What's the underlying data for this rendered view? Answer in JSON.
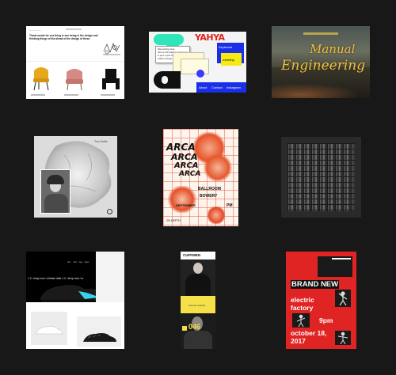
{
  "gallery": {
    "tiles": [
      {
        "id": "furniture",
        "nav": "— — — —",
        "tagline": "Thank words for one thing is one being in the design and thinking things of the ahead of the design of these."
      },
      {
        "id": "collage",
        "dialog_lines": [
          "Was working since",
          "Web on GIF loading on figures it",
          "to sync a year of ages",
          "a little a change in blog"
        ],
        "nav_links": [
          "About",
          "Contact",
          "Instagram"
        ],
        "headline": "YAHYA",
        "tag_right": "Keyboard",
        "tag_right2": "wedding"
      },
      {
        "id": "manual-engineering",
        "title_line1": "Manual",
        "title_line2": "Engineering"
      },
      {
        "id": "cloud",
        "label": "Tom Smith"
      },
      {
        "id": "arca-poster",
        "words": [
          "ARCA",
          "ARCA",
          "ARCA",
          "ARCA"
        ],
        "label_ballroom": "BALLROOM",
        "label_bowery": "BOWERY",
        "label_month": "SEPTEMBER",
        "label_pm": "PM",
        "label_bottom": "2% DEPTH"
      },
      {
        "id": "mosaic"
      },
      {
        "id": "sneakers",
        "nav_small": "dot · mt3 · sgs · tiger",
        "ticker": "1.2 / shop now / release date 1.2 / shop now / re"
      },
      {
        "id": "cuffmen",
        "brand": "CUFFMEN",
        "caption": "mental quality",
        "number": "046"
      },
      {
        "id": "brand-new",
        "headline": "BRAND NEW",
        "line1": "electric",
        "line2": "factory",
        "time": "9pm",
        "date_line1": "october 18,",
        "date_line2": "2017"
      }
    ]
  }
}
